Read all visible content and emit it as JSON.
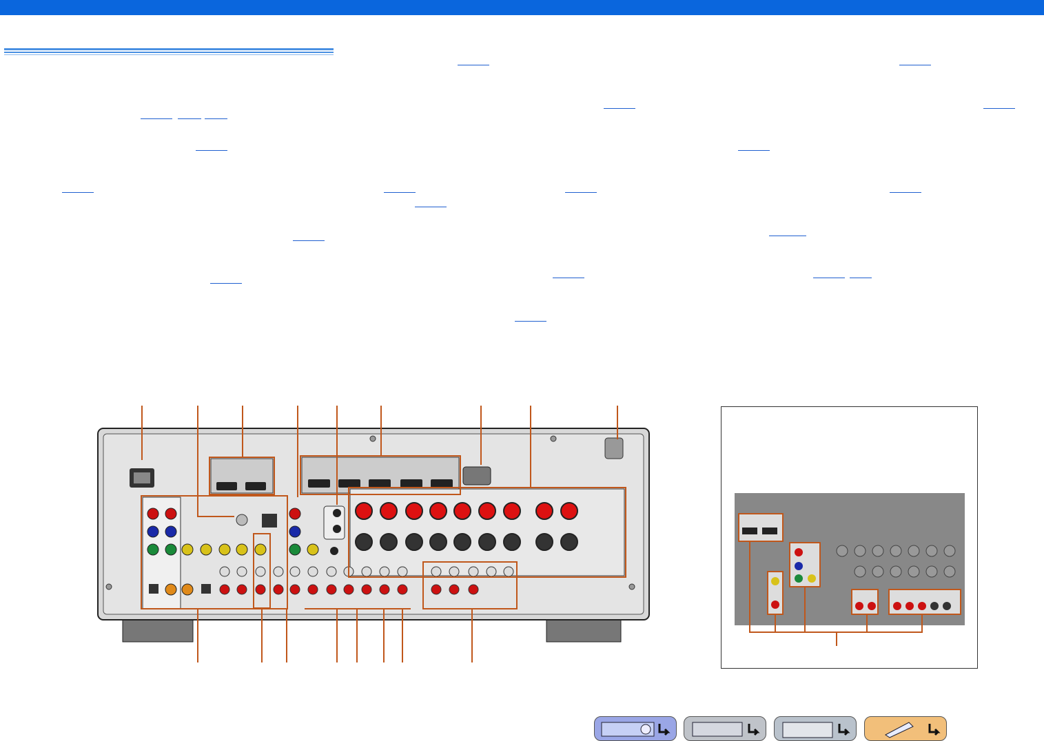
{
  "header": {
    "bar_color": "#0a66dd"
  },
  "colors": {
    "accent_rule": "#4a90e2",
    "link": "#1f5fd0",
    "callout": "#c0571b"
  },
  "figures": {
    "rear_panel": {
      "icon": "receiver-rear-panel-illustration"
    },
    "inset": {
      "icon": "rear-panel-inset-illustration"
    }
  },
  "nav": [
    {
      "icon": "front-panel-icon"
    },
    {
      "icon": "settings-menu-icon"
    },
    {
      "icon": "grid-menu-icon"
    },
    {
      "icon": "remote-control-icon"
    }
  ]
}
